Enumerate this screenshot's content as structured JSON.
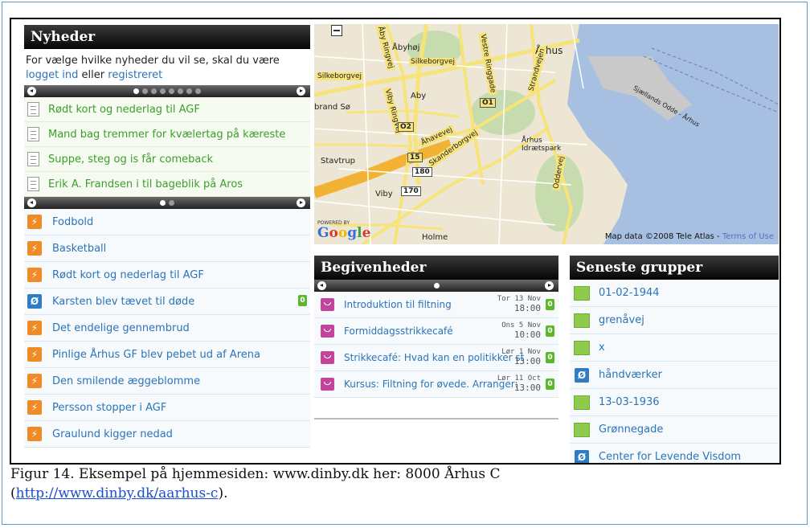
{
  "news": {
    "title": "Nyheder",
    "intro_text": "For vælge hvilke nyheder du vil se, skal du være",
    "login_link": "logget ind",
    "or_text": "eller",
    "register_link": "registreret",
    "items": [
      {
        "label": "Rødt kort og nederlag til AGF"
      },
      {
        "label": "Mand bag tremmer for kvælertag på kæreste"
      },
      {
        "label": "Suppe, steg og is får comeback"
      },
      {
        "label": "Erik A. Frandsen i til bageblik på Aros"
      }
    ]
  },
  "activity": {
    "items": [
      {
        "label": "Fodbold",
        "type": "run"
      },
      {
        "label": "Basketball",
        "type": "run"
      },
      {
        "label": "Rødt kort og nederlag til AGF",
        "type": "run"
      },
      {
        "label": "Karsten blev tævet til døde",
        "type": "group",
        "count": "0"
      },
      {
        "label": "Det endelige gennembrud",
        "type": "run"
      },
      {
        "label": "Pinlige Århus GF blev pebet ud af Arena",
        "type": "run"
      },
      {
        "label": "Den smilende æggeblomme",
        "type": "run"
      },
      {
        "label": "Persson stopper i AGF",
        "type": "run"
      },
      {
        "label": "Graulund kigger nedad",
        "type": "run"
      }
    ]
  },
  "map": {
    "labels": {
      "abyhoj": "Åbyhøj",
      "aarhus": "Århus",
      "aby": "Aby",
      "brand_so": "brand Sø",
      "stavtrup": "Stavtrup",
      "viby": "Viby",
      "holme": "Holme",
      "idraetspark": "Århus Idrætspark",
      "sjaellands_odde": "Sjællands Odde - Århus",
      "silkeborgvej": "Silkeborgvej",
      "silkeborgvej2": "Silkeborgvej",
      "ringgade": "Vestre Ringgade",
      "skanderborgvej": "Skanderborgvej",
      "ahavevej": "Åhavevej",
      "strandvej": "Strandvejen",
      "odderve": "Oddervej",
      "viby_ringvej": "Viby Ringvej",
      "abyhoj_ringvej": "Åby Ringvej"
    },
    "shields": {
      "o1": "O1",
      "o2": "O2",
      "r15": "15",
      "r180": "180",
      "r170": "170"
    },
    "powered_by": "POWERED BY",
    "google": "Google",
    "attribution": "Map data ©2008 Tele Atlas -",
    "terms": "Terms of Use"
  },
  "events": {
    "title": "Begivenheder",
    "items": [
      {
        "title": "Introduktion til filtning",
        "day": "Tor 13 Nov",
        "time": "18:00",
        "count": "0"
      },
      {
        "title": "Formiddagsstrikkecafé",
        "day": "Ons 5 Nov",
        "time": "10:00",
        "count": "0"
      },
      {
        "title": "Strikkecafé: Hvad kan en politikker st",
        "day": "Lør 1 Nov",
        "time": "13:00",
        "count": "0"
      },
      {
        "title": "Kursus: Filtning for øvede. Arranger:",
        "day": "Lør 11 Oct",
        "time": "13:00",
        "count": "0"
      }
    ]
  },
  "groups": {
    "title": "Seneste grupper",
    "items": [
      {
        "label": "01-02-1944",
        "type": "green"
      },
      {
        "label": "grenåvej",
        "type": "green"
      },
      {
        "label": "x",
        "type": "green"
      },
      {
        "label": "håndværker",
        "type": "blue"
      },
      {
        "label": "13-03-1936",
        "type": "green"
      },
      {
        "label": "Grønnegade",
        "type": "green"
      },
      {
        "label": "Center for Levende Visdom",
        "type": "blue"
      }
    ]
  },
  "caption": {
    "line1": "Figur 14. Eksempel på hjemmesiden: www.dinby.dk her: 8000 Århus C",
    "open_paren": "(",
    "link": "http://www.dinby.dk/aarhus-c",
    "close": ")."
  },
  "colors": {
    "accent_link": "#2a74b8",
    "news_link": "#3d9d2c",
    "activity_icon": "#f08a24",
    "event_icon": "#c2449b",
    "group_icon_green": "#8dca4e",
    "group_icon_blue": "#2f7cc2",
    "count_badge": "#5cb82a"
  }
}
